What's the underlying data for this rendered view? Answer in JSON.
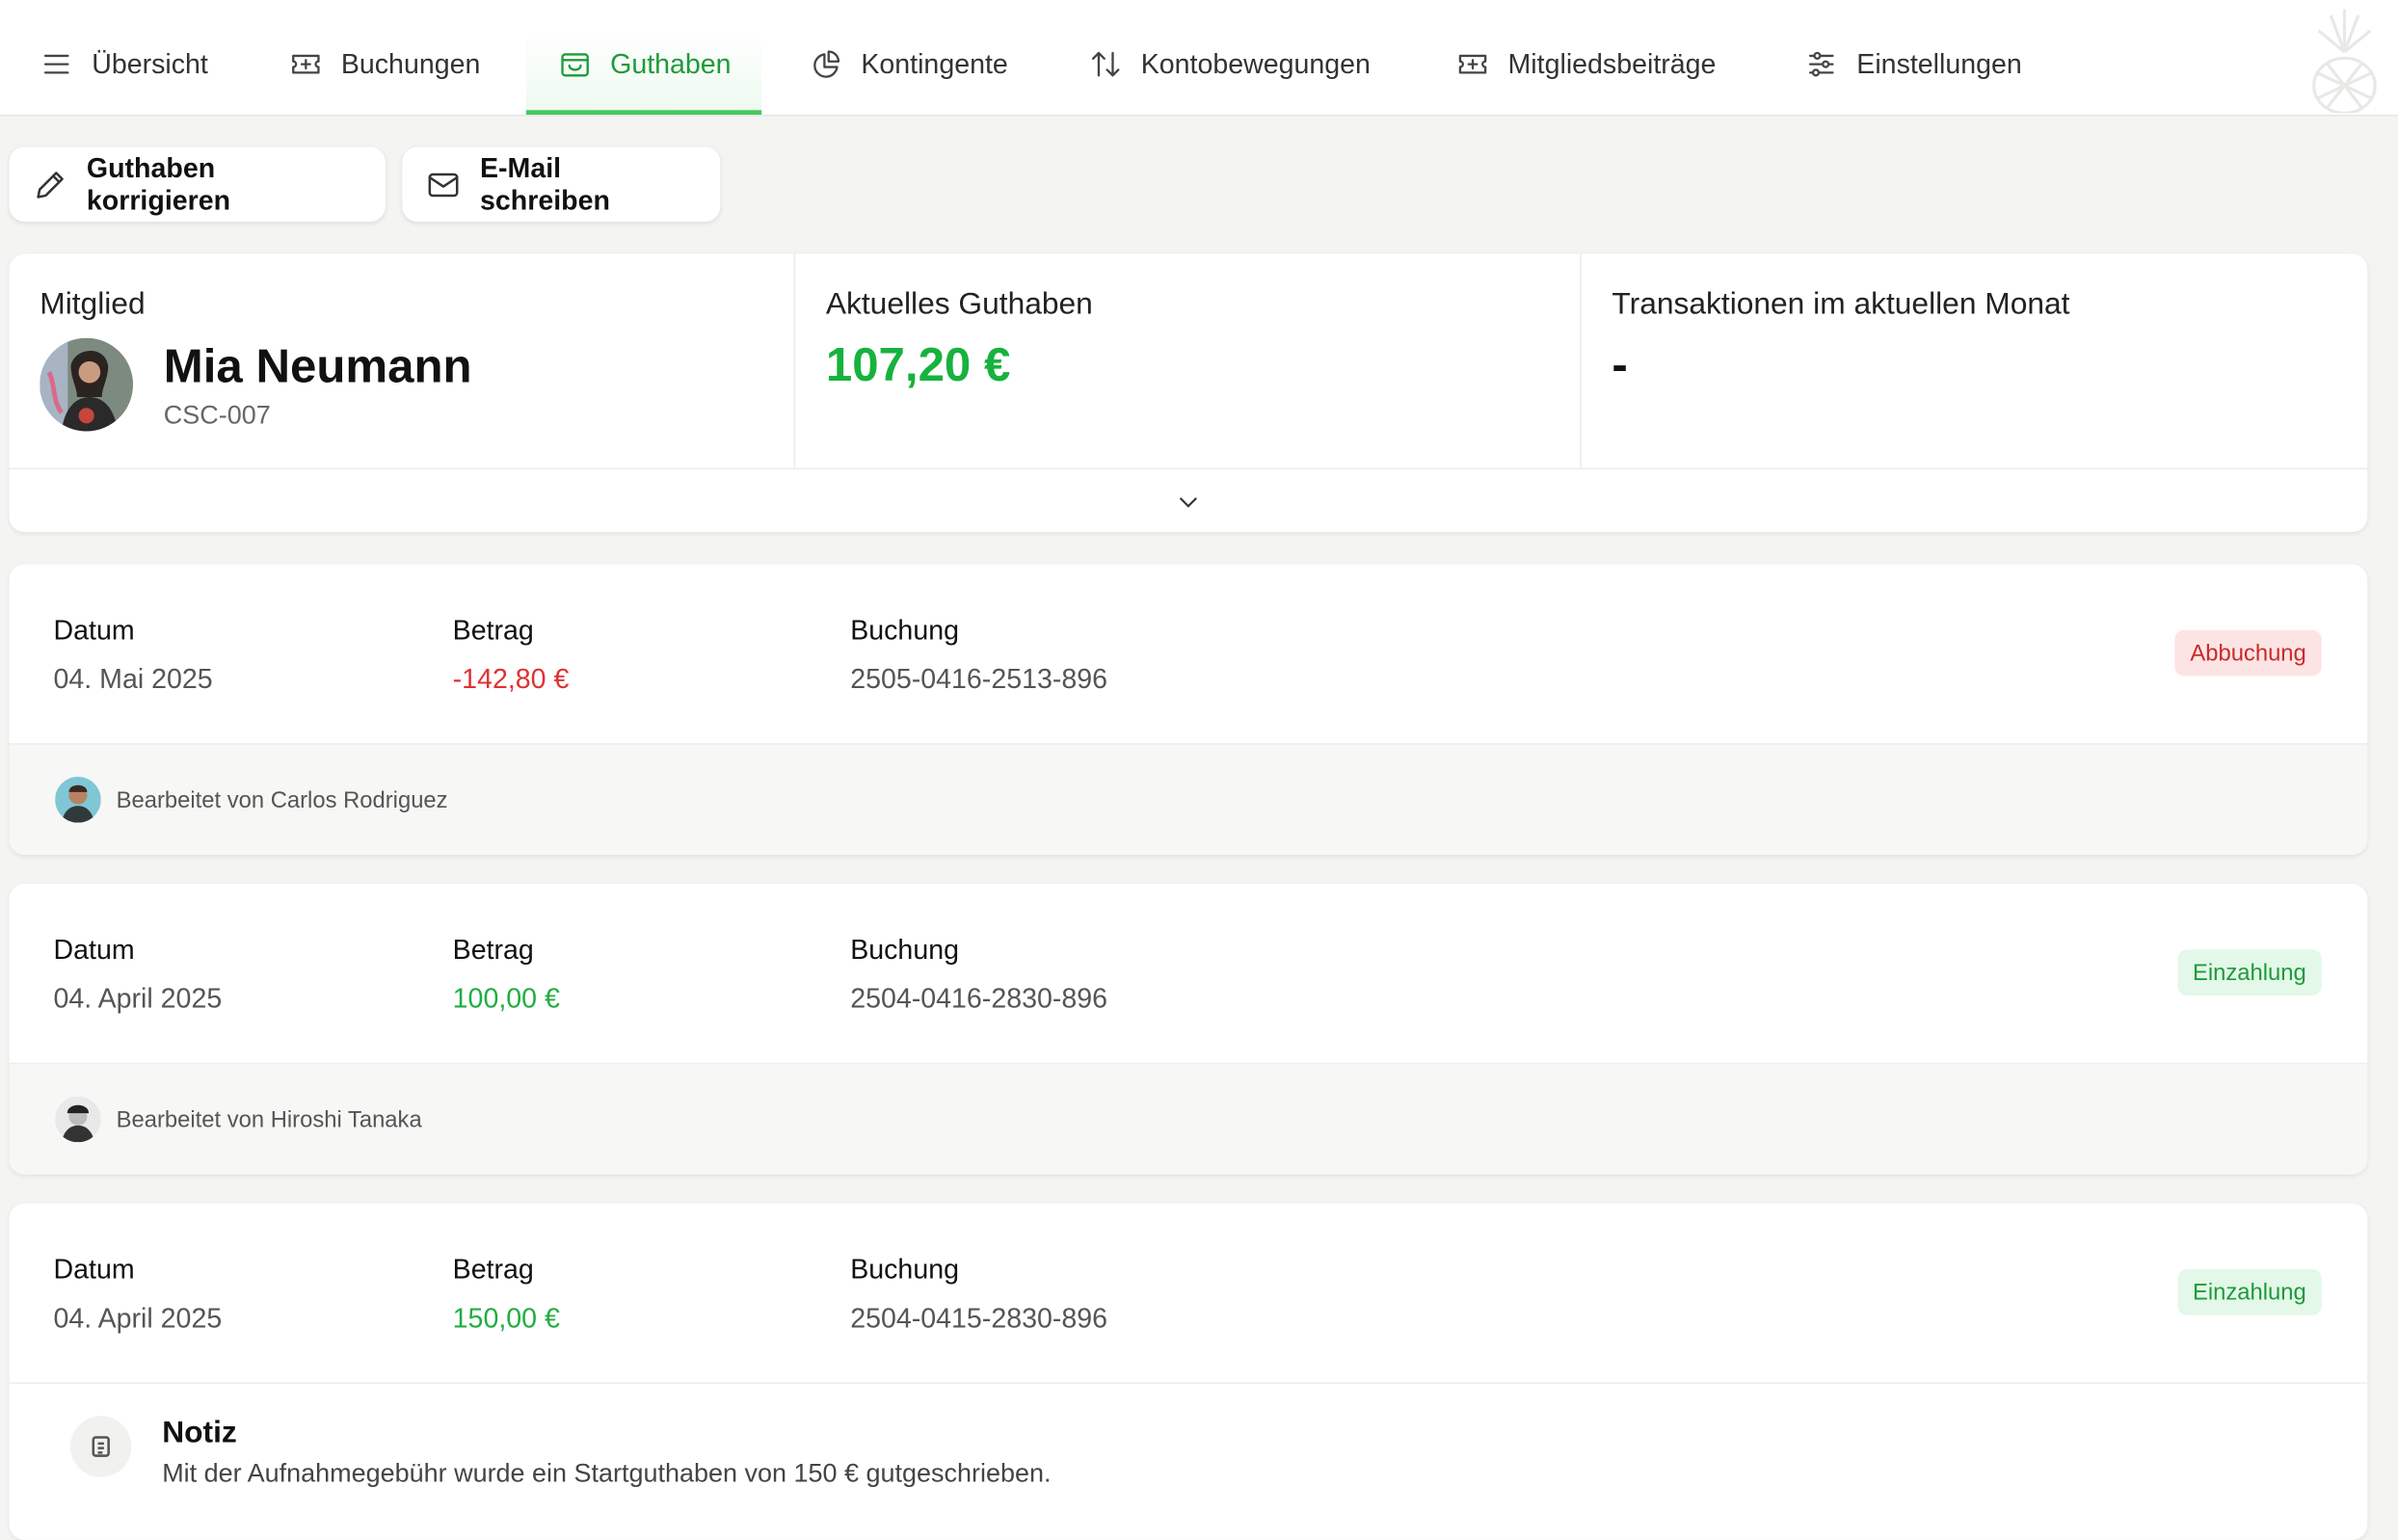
{
  "nav": {
    "tabs": [
      {
        "label": "Übersicht",
        "icon": "menu-icon"
      },
      {
        "label": "Buchungen",
        "icon": "ticket-icon"
      },
      {
        "label": "Guthaben",
        "icon": "wallet-icon",
        "active": true
      },
      {
        "label": "Kontingente",
        "icon": "pie-chart-icon"
      },
      {
        "label": "Kontobewegungen",
        "icon": "arrows-up-down-icon"
      },
      {
        "label": "Mitgliedsbeiträge",
        "icon": "ticket-icon"
      },
      {
        "label": "Einstellungen",
        "icon": "sliders-icon"
      }
    ],
    "accent": "#1f9a3a"
  },
  "actions": {
    "correct_label": "Guthaben korrigieren",
    "email_label": "E-Mail schreiben"
  },
  "summary": {
    "member_label": "Mitglied",
    "member_name": "Mia Neumann",
    "member_id": "CSC-007",
    "balance_label": "Aktuelles Guthaben",
    "balance_value": "107,20 €",
    "transactions_label": "Transaktionen im aktuellen Monat",
    "transactions_value": "-"
  },
  "transactions": [
    {
      "date_label": "Datum",
      "date": "04. Mai 2025",
      "amount_label": "Betrag",
      "amount": "-142,80 €",
      "booking_label": "Buchung",
      "booking": "2505-0416-2513-896",
      "type": "Abbuchung",
      "edited_by": "Bearbeitet von Carlos Rodriguez"
    },
    {
      "date_label": "Datum",
      "date": "04. April 2025",
      "amount_label": "Betrag",
      "amount": "100,00 €",
      "booking_label": "Buchung",
      "booking": "2504-0416-2830-896",
      "type": "Einzahlung",
      "edited_by": "Bearbeitet von Hiroshi Tanaka"
    },
    {
      "date_label": "Datum",
      "date": "04. April 2025",
      "amount_label": "Betrag",
      "amount": "150,00 €",
      "booking_label": "Buchung",
      "booking": "2504-0415-2830-896",
      "type": "Einzahlung",
      "note_title": "Notiz",
      "note_text": "Mit der Aufnahmegebühr wurde ein Startguthaben von 150 € gutgeschrieben."
    }
  ],
  "colors": {
    "positive": "#1fae41",
    "negative": "#e03131"
  }
}
